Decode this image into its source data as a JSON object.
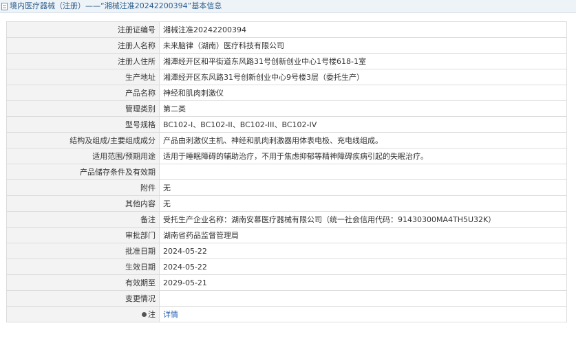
{
  "header": {
    "title": "境内医疗器械（注册）——“湘械注准20242200394”基本信息"
  },
  "rows": [
    {
      "label": "注册证编号",
      "value": "湘械注准20242200394"
    },
    {
      "label": "注册人名称",
      "value": "未来脑律（湖南）医疗科技有限公司"
    },
    {
      "label": "注册人住所",
      "value": "湘潭经开区和平街道东风路31号创新创业中心1号楼618-1室"
    },
    {
      "label": "生产地址",
      "value": "湘潭经开区东风路31号创新创业中心9号楼3层（委托生产）"
    },
    {
      "label": "产品名称",
      "value": "神经和肌肉刺激仪"
    },
    {
      "label": "管理类别",
      "value": "第二类"
    },
    {
      "label": "型号规格",
      "value": "BC102-I、BC102-II、BC102-III、BC102-IV"
    },
    {
      "label": "结构及组成/主要组成成分",
      "value": "产品由刺激仪主机、神经和肌肉刺激器用体表电极、充电线组成。"
    },
    {
      "label": "适用范围/预期用途",
      "value": "适用于睡眠障碍的辅助治疗，不用于焦虑抑郁等精神障碍疾病引起的失眠治疗。"
    },
    {
      "label": "产品储存条件及有效期",
      "value": ""
    },
    {
      "label": "附件",
      "value": "无"
    },
    {
      "label": "其他内容",
      "value": "无"
    },
    {
      "label": "备注",
      "value": "受托生产企业名称：湖南安慕医疗器械有限公司（统一社会信用代码：91430300MA4TH5U32K）"
    },
    {
      "label": "审批部门",
      "value": "湖南省药品监督管理局"
    },
    {
      "label": "批准日期",
      "value": "2024-05-22"
    },
    {
      "label": "生效日期",
      "value": "2024-05-22"
    },
    {
      "label": "有效期至",
      "value": "2029-05-21"
    },
    {
      "label": "变更情况",
      "value": ""
    }
  ],
  "note_row": {
    "label": "注",
    "icon": "pin-icon",
    "link_text": "详情"
  }
}
